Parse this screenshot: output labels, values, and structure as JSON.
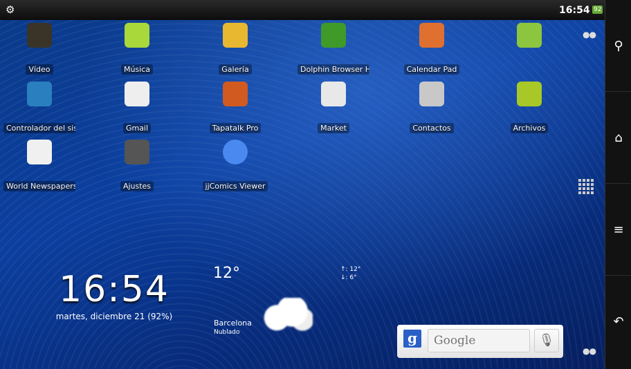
{
  "status_bar": {
    "time": "16:54",
    "battery": "92",
    "usb_icon": "usb-debug-icon"
  },
  "apps": [
    {
      "label": "Vídeo",
      "icon": "video-icon",
      "color": "#3a3428"
    },
    {
      "label": "Música",
      "icon": "music-icon",
      "color": "#a8d83a"
    },
    {
      "label": "Galería",
      "icon": "gallery-icon",
      "color": "#e8b830"
    },
    {
      "label": "Dolphin Browser HD",
      "icon": "dolphin-browser-icon",
      "color": "#3f9a2a"
    },
    {
      "label": "Calendar Pad",
      "icon": "calendar-icon",
      "color": "#e07030"
    },
    {
      "label": "",
      "icon": "android-app-icon",
      "color": "#8cc63e"
    },
    {
      "label": "Controlador del siste",
      "icon": "system-monitor-icon",
      "color": "#2a7fbf"
    },
    {
      "label": "Gmail",
      "icon": "gmail-icon",
      "color": "#eeeeee"
    },
    {
      "label": "Tapatalk Pro",
      "icon": "tapatalk-icon",
      "color": "#d05a20"
    },
    {
      "label": "Market",
      "icon": "market-icon",
      "color": "#e8e8e8"
    },
    {
      "label": "Contactos",
      "icon": "contacts-icon",
      "color": "#c8c8c8"
    },
    {
      "label": "Archivos",
      "icon": "files-icon",
      "color": "#a8c828"
    },
    {
      "label": "World Newspapers",
      "icon": "newspaper-icon",
      "color": "#f0f0f0"
    },
    {
      "label": "Ajustes",
      "icon": "settings-icon",
      "color": "#555"
    },
    {
      "label": "jjComics Viewer",
      "icon": "speech-bubble-icon",
      "color": "#4a8af0"
    }
  ],
  "clock": {
    "time": "16:54",
    "date": "martes, diciembre 21 (92%)"
  },
  "weather": {
    "temp": "12°",
    "high": "↑: 12°",
    "low": "↓: 6°",
    "city": "Barcelona",
    "condition": "Nublado"
  },
  "search": {
    "placeholder": "Google"
  }
}
